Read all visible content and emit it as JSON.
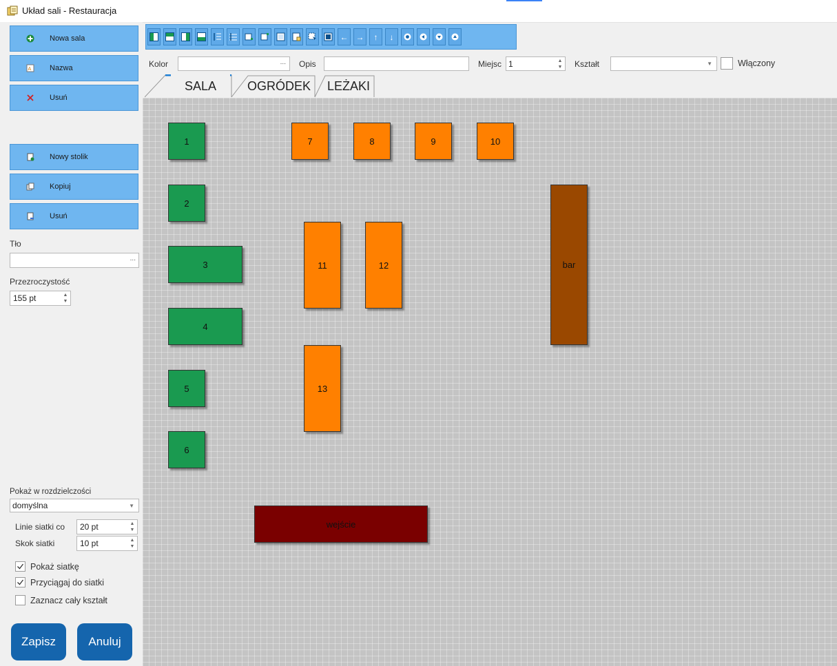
{
  "window": {
    "title": "Układ sali - Restauracja"
  },
  "sidebar": {
    "room_buttons": [
      {
        "label": "Nowa sala",
        "icon": "add-circle-icon"
      },
      {
        "label": "Nazwa",
        "icon": "rename-icon"
      },
      {
        "label": "Usuń",
        "icon": "delete-x-icon"
      }
    ],
    "table_buttons": [
      {
        "label": "Nowy stolik",
        "icon": "new-table-icon"
      },
      {
        "label": "Kopiuj",
        "icon": "copy-icon"
      },
      {
        "label": "Usuń",
        "icon": "remove-table-icon"
      }
    ],
    "background_label": "Tło",
    "background_value": "",
    "browse": "...",
    "opacity_label": "Przezroczystość",
    "opacity_value": "155 pt",
    "resolution_label": "Pokaż w rozdzielczości",
    "resolution_value": "domyślna",
    "grid_lines_label": "Linie siatki co",
    "grid_lines_value": "20 pt",
    "grid_step_label": "Skok siatki",
    "grid_step_value": "10 pt",
    "checks": [
      {
        "label": "Pokaż siatkę",
        "checked": true
      },
      {
        "label": "Przyciągaj do siatki",
        "checked": true
      },
      {
        "label": "Zaznacz cały kształt",
        "checked": false
      }
    ],
    "save_label": "Zapisz",
    "cancel_label": "Anuluj"
  },
  "properties": {
    "color_label": "Kolor",
    "color_value": "",
    "browse": "...",
    "desc_label": "Opis",
    "desc_value": "",
    "seats_label": "Miejsc",
    "seats_value": "1",
    "shape_label": "Kształt",
    "shape_value": "",
    "enabled_label": "Włączony",
    "enabled_checked": false
  },
  "toolbar": {
    "icons": [
      "align-left-icon",
      "align-top-icon",
      "align-right-icon",
      "align-bottom-icon",
      "distribute-vertical-icon",
      "distribute-horizontal-icon",
      "same-width-icon",
      "same-height-icon",
      "same-size-icon",
      "size-to-grid-icon",
      "select-all-icon",
      "select-frame-icon",
      "arrow-left-icon",
      "arrow-right-icon",
      "arrow-up-icon",
      "arrow-down-icon",
      "circle-right-icon",
      "circle-left-icon",
      "circle-down-icon",
      "circle-up-icon"
    ]
  },
  "tabs": [
    {
      "label": "SALA",
      "active": true
    },
    {
      "label": "OGRÓDEK",
      "active": false
    },
    {
      "label": "LEŻAKI",
      "active": false
    }
  ],
  "colors": {
    "green_table": "#1a9a50",
    "orange_table": "#ff8000",
    "bar": "#9a4800",
    "entrance": "#7a0000"
  },
  "layout": {
    "tables": [
      {
        "label": "1",
        "color": "green"
      },
      {
        "label": "2",
        "color": "green"
      },
      {
        "label": "3",
        "color": "green"
      },
      {
        "label": "4",
        "color": "green"
      },
      {
        "label": "5",
        "color": "green"
      },
      {
        "label": "6",
        "color": "green"
      },
      {
        "label": "7",
        "color": "orange"
      },
      {
        "label": "8",
        "color": "orange"
      },
      {
        "label": "9",
        "color": "orange"
      },
      {
        "label": "10",
        "color": "orange"
      },
      {
        "label": "11",
        "color": "orange"
      },
      {
        "label": "12",
        "color": "orange"
      },
      {
        "label": "13",
        "color": "orange"
      }
    ],
    "bar_label": "bar",
    "entrance_label": "wejście"
  }
}
